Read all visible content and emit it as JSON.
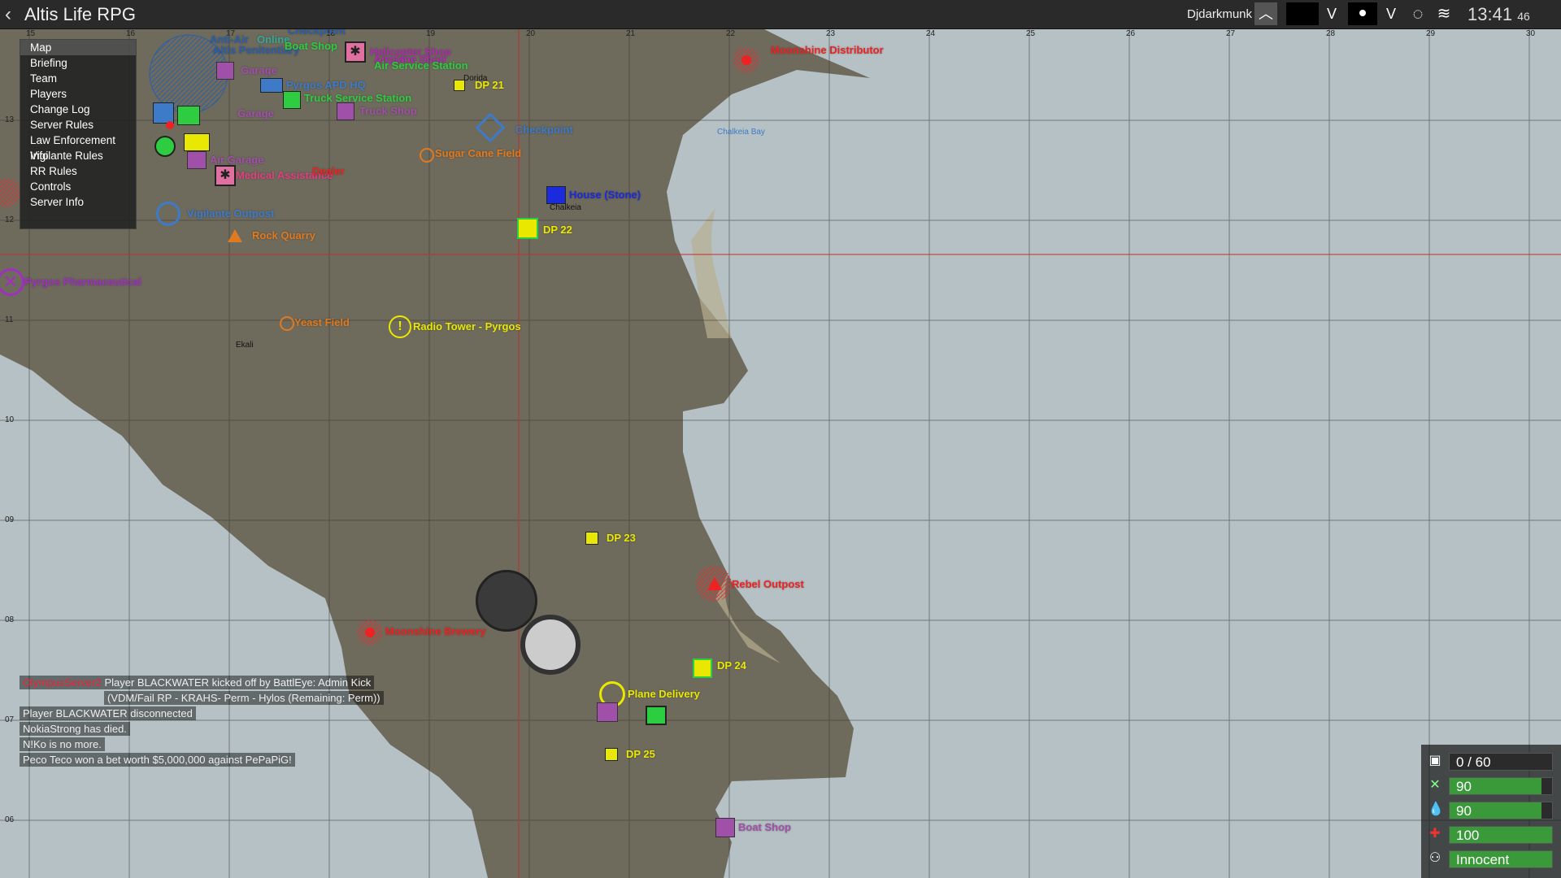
{
  "topbar": {
    "title": "Altis Life RPG",
    "player": "Djdarkmunk",
    "time": "13:41",
    "seconds": "46",
    "icons": [
      "back-chevron",
      "chevron-up",
      "chevron-down",
      "dot",
      "chevron-down",
      "gear",
      "layers"
    ]
  },
  "menu": {
    "items": [
      "Map",
      "Briefing",
      "Team",
      "Players",
      "Change Log",
      "Server Rules",
      "Law Enforcement Info",
      "Vigilante Rules",
      "RR Rules",
      "Controls",
      "Server Info"
    ],
    "selected": "Map"
  },
  "map_labels": {
    "checkpoint_top": "Checkpoint",
    "anti_air": "Anti-Air",
    "online": "Online",
    "penitentiary": "Altis Penitentiary",
    "boat_shop_top": "Boat Shop",
    "helicopter_shop": "Helicopter Shop",
    "airplane_shop": "Airplane Shop",
    "air_service_station": "Air Service Station",
    "moonshine_distributor": "Moonshine Distributor",
    "garage1": "Garage",
    "dorida": "Dorida",
    "dp21": "DP 21",
    "pygros_apd": "Pyrgos APD HQ",
    "truck_service_station": "Truck Service Station",
    "truck_shop": "Truck Shop",
    "garage2": "Garage",
    "checkpoint_mid": "Checkpoint",
    "chalkeia_bay": "Chalkeia Bay",
    "sugar_cane": "Sugar Cane Field",
    "medical_assistance": "Medical Assistance",
    "dealer": "Dealer",
    "air_garage": "Air Garage",
    "house_stone": "House (Stone)",
    "chalkeia": "Chalkeia",
    "dp22": "DP 22",
    "vigilante_outpost": "Vigilante Outpost",
    "rock_quarry": "Rock Quarry",
    "pyrgos_pharma": "Pyrgos Pharmaceutical",
    "yeast_field": "Yeast Field",
    "radio_tower": "Radio Tower - Pyrgos",
    "ekali": "Ekali",
    "dp23": "DP 23",
    "rebel_outpost": "Rebel Outpost",
    "moonshine_brewery": "Moonshine Brewery",
    "dp24": "DP 24",
    "plane_delivery": "Plane Delivery",
    "dp25": "DP 25",
    "boat_shop_bottom": "Boat Shop"
  },
  "chat": {
    "line1_server": "OlympusServer2",
    "line1_text": "Player BLACKWATER kicked off by BattlEye: Admin Kick",
    "line1_reason": "(VDM/Fail RP - KRAHS- Perm - Hylos (Remaining: Perm))",
    "line2": "Player BLACKWATER disconnected",
    "line3": "NokiaStrong has died.",
    "line4": "N!Ko is no more.",
    "line5": "Peco Teco won a bet worth $5,000,000 against PePaPiG!"
  },
  "hud": {
    "inventory": "0 / 60",
    "food": "90",
    "water": "90",
    "health": "100",
    "status": "Innocent",
    "food_pct": 0.9,
    "water_pct": 0.9,
    "health_pct": 1.0,
    "status_pct": 1.0
  },
  "grid": {
    "top_cols": [
      "15",
      "16",
      "17",
      "18",
      "19",
      "20",
      "21",
      "22",
      "23",
      "24",
      "25",
      "26",
      "27",
      "28",
      "29",
      "30"
    ],
    "rows": [
      "13",
      "12",
      "11",
      "10",
      "09",
      "08",
      "07",
      "06"
    ]
  }
}
